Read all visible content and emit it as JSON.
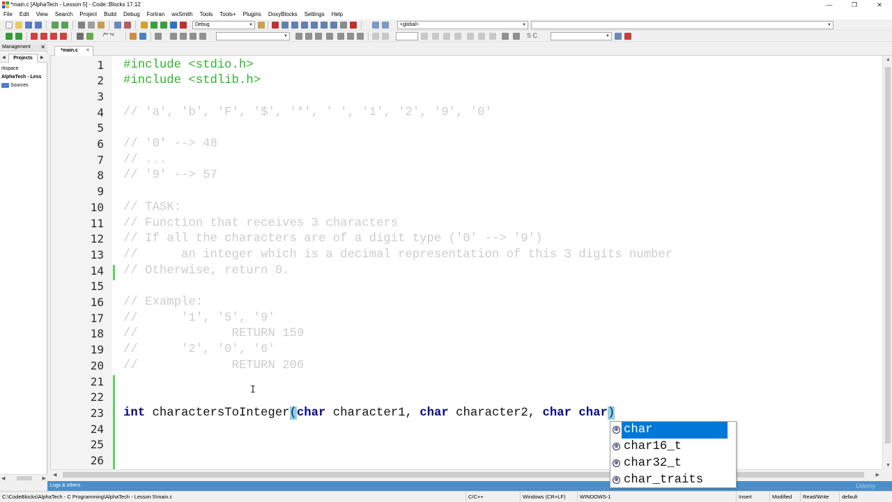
{
  "window": {
    "title": "*main.c [AlphaTech - Lesson 5] - Code::Blocks 17.12",
    "minimize": "—",
    "maximize": "❐",
    "close": "✕"
  },
  "menu": [
    "File",
    "Edit",
    "View",
    "Search",
    "Project",
    "Build",
    "Debug",
    "Fortran",
    "wxSmith",
    "Tools",
    "Tools+",
    "Plugins",
    "DoxyBlocks",
    "Settings",
    "Help"
  ],
  "toolbar": {
    "build_target": "Debug",
    "scope": "<global>",
    "doxy_label": "/** *<",
    "search_sc": "S C"
  },
  "management": {
    "title": "Management",
    "close": "✕",
    "tab": "Projects",
    "tree": [
      "rkspace",
      "AlphaTech - Less",
      "Sources"
    ]
  },
  "editor": {
    "tab_label": "*main.c",
    "tab_close": "✕",
    "lines": [
      {
        "n": "1",
        "kind": "pre",
        "text": "#include <stdio.h>"
      },
      {
        "n": "2",
        "kind": "pre",
        "text": "#include <stdlib.h>"
      },
      {
        "n": "3",
        "kind": "code",
        "text": ""
      },
      {
        "n": "4",
        "kind": "com",
        "text": "// 'a', 'b', 'F', '$', '*', ' ', '1', '2', '9', '0'"
      },
      {
        "n": "5",
        "kind": "code",
        "text": ""
      },
      {
        "n": "6",
        "kind": "com",
        "text": "// '0' --> 48"
      },
      {
        "n": "7",
        "kind": "com",
        "text": "// ..."
      },
      {
        "n": "8",
        "kind": "com",
        "text": "// '9' --> 57"
      },
      {
        "n": "9",
        "kind": "code",
        "text": ""
      },
      {
        "n": "10",
        "kind": "com",
        "text": "// TASK:"
      },
      {
        "n": "11",
        "kind": "com",
        "text": "// Function that receives 3 characters"
      },
      {
        "n": "12",
        "kind": "com",
        "text": "// If all the characters are of a digit type ('0' --> '9')"
      },
      {
        "n": "13",
        "kind": "com",
        "text": "//      an integer which is a decimal representation of this 3 digits number"
      },
      {
        "n": "14",
        "kind": "com",
        "text": "// Otherwise, return 0."
      },
      {
        "n": "15",
        "kind": "code",
        "text": ""
      },
      {
        "n": "16",
        "kind": "com",
        "text": "// Example:"
      },
      {
        "n": "17",
        "kind": "com",
        "text": "//      '1', '5', '9'"
      },
      {
        "n": "18",
        "kind": "com",
        "text": "//             RETURN 159"
      },
      {
        "n": "19",
        "kind": "com",
        "text": "//      '2', '0', '6'"
      },
      {
        "n": "20",
        "kind": "com",
        "text": "//             RETURN 206"
      },
      {
        "n": "21",
        "kind": "code",
        "text": ""
      },
      {
        "n": "22",
        "kind": "code",
        "text": ""
      },
      {
        "n": "23",
        "kind": "func",
        "text": ""
      },
      {
        "n": "24",
        "kind": "code",
        "text": ""
      },
      {
        "n": "25",
        "kind": "code",
        "text": ""
      },
      {
        "n": "26",
        "kind": "code",
        "text": ""
      }
    ],
    "line23": {
      "kw_int": "int",
      "name": " charactersToInteger",
      "open": "(",
      "kw1": "char",
      "p1": " character1, ",
      "kw2": "char",
      "p2": " character2, ",
      "kw3": "char",
      "sp": " ",
      "typed": "char",
      "close": ")"
    }
  },
  "autocomplete": {
    "icon": "⊕",
    "items": [
      "char",
      "char16_t",
      "char32_t",
      "char_traits"
    ],
    "selected": 0
  },
  "logs": {
    "title": "Logs & others"
  },
  "status": {
    "path": "C:\\CodeBlocks\\AlphaTech - C Programming\\AlphaTech - Lesson 5\\main.c",
    "language": "C/C++",
    "eol": "Windows (CR+LF)",
    "encoding": "WINDOWS-1",
    "insert": "Insert",
    "modified": "Modified",
    "rw": "Read/Write",
    "profile": "default"
  },
  "colors": {
    "preprocessor": "#2eb52e",
    "comment": "#cdcdcd",
    "keyword": "#0a0a80",
    "selection": "#0078d7",
    "logs_bar": "#4a8fc9",
    "change_marker": "#59d259"
  },
  "watermark": "Udemy"
}
